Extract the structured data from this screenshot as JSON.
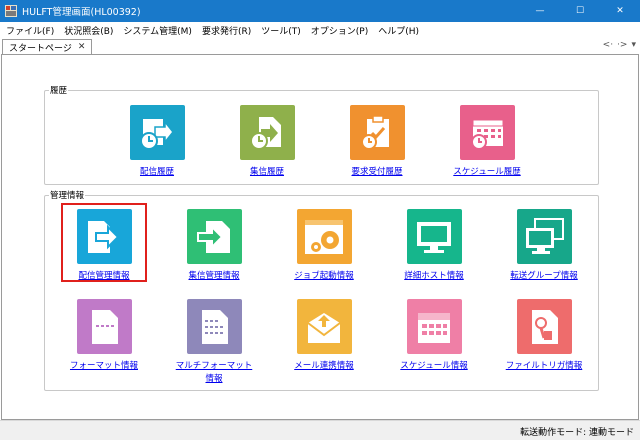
{
  "window": {
    "title": "HULFT管理画面(HL00392)",
    "controls": {
      "minimize": "—",
      "maximize": "☐",
      "close": "✕"
    }
  },
  "menu": [
    "ファイル(F)",
    "状況照会(B)",
    "システム管理(M)",
    "要求発行(R)",
    "ツール(T)",
    "オプション(P)",
    "ヘルプ(H)"
  ],
  "tab": {
    "label": "スタートページ",
    "close": "✕",
    "nav_prev": "<·",
    "nav_next": "·>",
    "nav_menu": "▾"
  },
  "history_group": {
    "title": "履歴",
    "items": [
      {
        "label": "配信履歴",
        "icon": "send-history-icon",
        "color": "#1aa3c9"
      },
      {
        "label": "集信履歴",
        "icon": "receive-history-icon",
        "color": "#8fb04b"
      },
      {
        "label": "要求受付履歴",
        "icon": "request-history-icon",
        "color": "#f0912f"
      },
      {
        "label": "スケジュール履歴",
        "icon": "schedule-history-icon",
        "color": "#e8608b"
      }
    ]
  },
  "management_group": {
    "title": "管理情報",
    "row1": [
      {
        "label": "配信管理情報",
        "icon": "send-management-icon",
        "color": "#18a6d9"
      },
      {
        "label": "集信管理情報",
        "icon": "receive-management-icon",
        "color": "#2fbf75"
      },
      {
        "label": "ジョブ起動情報",
        "icon": "job-start-icon",
        "color": "#f3a632"
      },
      {
        "label": "詳細ホスト情報",
        "icon": "host-detail-icon",
        "color": "#16b68c"
      },
      {
        "label": "転送グループ情報",
        "icon": "transfer-group-icon",
        "color": "#17a78a"
      }
    ],
    "row2": [
      {
        "label": "フォーマット情報",
        "icon": "format-icon",
        "color": "#c07ac8"
      },
      {
        "label_line1": "マルチフォーマット",
        "label_line2": "情報",
        "icon": "multi-format-icon",
        "color": "#8e88ba"
      },
      {
        "label": "メール連携情報",
        "icon": "mail-icon",
        "color": "#f2b53d"
      },
      {
        "label": "スケジュール情報",
        "icon": "schedule-icon",
        "color": "#ef7fa6"
      },
      {
        "label": "ファイルトリガ情報",
        "icon": "file-trigger-icon",
        "color": "#ee6c6c"
      }
    ]
  },
  "status": {
    "text": "転送動作モード: 連動モード"
  },
  "selection": {
    "selected_item": "配信管理情報",
    "frame_color": "#e0201c"
  }
}
